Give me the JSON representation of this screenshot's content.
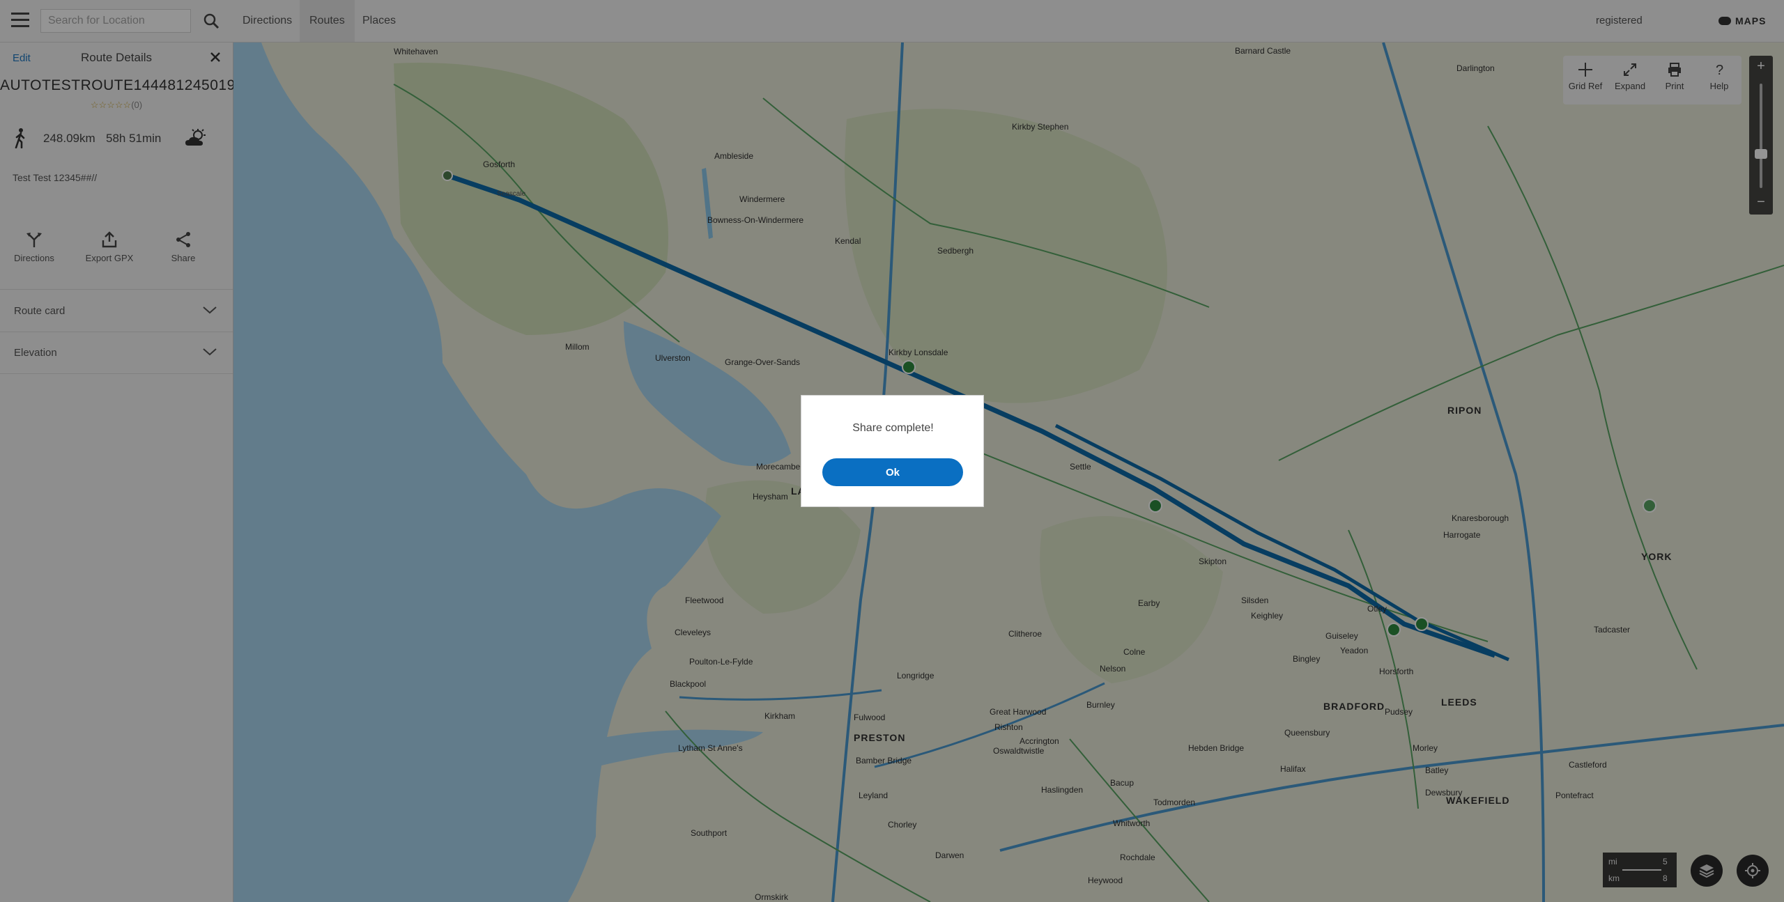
{
  "topbar": {
    "search_placeholder": "Search for Location",
    "tabs": [
      "Directions",
      "Routes",
      "Places"
    ],
    "active_tab": "Routes",
    "user_label": "registered",
    "brand": "MAPS"
  },
  "sidebar": {
    "edit_label": "Edit",
    "title": "Route Details",
    "route_name": "AUTOTESTROUTE1444812450193",
    "rating_stars": "☆☆☆☆☆",
    "rating_count": "(0)",
    "distance": "248.09km",
    "duration": "58h 51min",
    "description": "Test Test 12345##//",
    "actions": [
      "Directions",
      "Export GPX",
      "Share"
    ],
    "sections": [
      "Route card",
      "Elevation"
    ]
  },
  "map": {
    "tools": [
      "Grid Ref",
      "Expand",
      "Print",
      "Help"
    ],
    "zoom_in": "+",
    "zoom_out": "−",
    "scale": {
      "mi_label": "mi",
      "mi_value": "5",
      "km_label": "km",
      "km_value": "8"
    },
    "route_color": "#0d6aa8",
    "sea_color": "#a9d6f0",
    "land_color": "#e9ead9",
    "places": {
      "whitehaven": "Whitehaven",
      "gosforth": "Gosforth",
      "seascale": "Seascale",
      "ambleside": "Ambleside",
      "windermere": "Windermere",
      "bowness": "Bowness-On-Windermere",
      "kendal": "Kendal",
      "sedbergh": "Sedbergh",
      "kirkby_stephen": "Kirkby Stephen",
      "barnard_castle": "Barnard Castle",
      "darlington": "Darlington",
      "kirkby_lonsdale": "Kirkby Lonsdale",
      "ulverston": "Ulverston",
      "millom": "Millom",
      "grange": "Grange-Over-Sands",
      "morecambe": "Morecambe",
      "heysham": "Heysham",
      "lancaster": "LA",
      "settle": "Settle",
      "skipton": "Skipton",
      "ripon": "RIPON",
      "harrogate": "Harrogate",
      "knaresborough": "Knaresborough",
      "york": "YORK",
      "tadcaster": "Tadcaster",
      "otley": "Otley",
      "guiseley": "Guiseley",
      "yeadon": "Yeadon",
      "leeds": "LEEDS",
      "bradford": "BRADFORD",
      "wakefield": "WAKEFIELD",
      "fleetwood": "Fleetwood",
      "cleveleys": "Cleveleys",
      "poulton": "Poulton-Le-Fylde",
      "blackpool": "Blackpool",
      "kirkham": "Kirkham",
      "lytham": "Lytham St Anne's",
      "preston": "PRESTON",
      "fulwood": "Fulwood",
      "longridge": "Longridge",
      "clitheroe": "Clitheroe",
      "great_harwood": "Great Harwood",
      "accrington": "Accrington",
      "burnley": "Burnley",
      "nelson": "Nelson",
      "colne": "Colne",
      "keighley": "Keighley",
      "bingley": "Bingley",
      "silsden": "Silsden",
      "earby": "Earby",
      "horsforth": "Horsforth",
      "pudsey": "Pudsey",
      "halifax": "Halifax",
      "dewsbury": "Dewsbury",
      "castleford": "Castleford",
      "pontefract": "Pontefract",
      "leyland": "Leyland",
      "chorley": "Chorley",
      "southport": "Southport",
      "bamber_bridge": "Bamber Bridge",
      "darwen": "Darwen",
      "haslingden": "Haslingden",
      "rochdale": "Rochdale",
      "todmorden": "Todmorden",
      "hebden_bridge": "Hebden Bridge",
      "queensbury": "Queensbury",
      "morley": "Morley",
      "batley": "Batley",
      "ormskirk": "Ormskirk",
      "heywood": "Heywood",
      "whitworth": "Whitworth",
      "bacup": "Bacup",
      "rishton": "Rishton",
      "oswaldtwistle": "Oswaldtwistle"
    }
  },
  "modal": {
    "message": "Share complete!",
    "ok_label": "Ok"
  }
}
